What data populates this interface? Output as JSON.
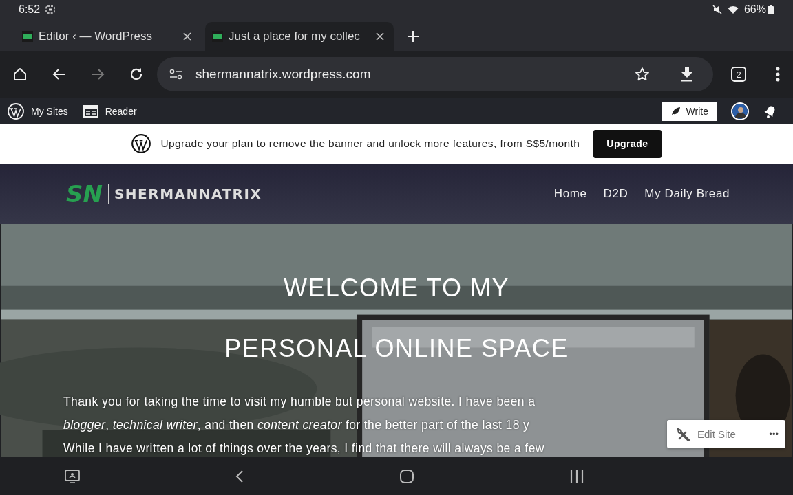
{
  "status_bar": {
    "time": "6:52",
    "battery": "66%"
  },
  "tabs": [
    {
      "title": "Editor ‹ — WordPress",
      "selected": false
    },
    {
      "title": "Just a place for my collec",
      "selected": true
    }
  ],
  "toolbar": {
    "url": "shermannatrix.wordpress.com",
    "tab_count": "2"
  },
  "admin_bar": {
    "items": [
      "My Sites",
      "Reader"
    ],
    "write": "Write"
  },
  "banner": {
    "text": "Upgrade your plan to remove the banner and unlock more features, from S$5/month",
    "button": "Upgrade"
  },
  "site": {
    "logo_mark": "SN",
    "logo_text": "SHERMANNATRIX",
    "nav": [
      "Home",
      "D2D",
      "My Daily Bread"
    ]
  },
  "hero": {
    "kind": "picture",
    "heading_lines": [
      "WELCOME TO MY",
      "PERSONAL ONLINE SPACE"
    ],
    "paragraph_lines": [
      "Thank you for taking the time to visit my humble but personal website. I have been a",
      "*blogger*, *technical writer*, and then *content creator* for the better part of the last 18 y",
      "While I have written a lot of things over the years, I find that there will always be a few"
    ]
  },
  "edit_site": {
    "label": "Edit Site",
    "more": "•••"
  }
}
